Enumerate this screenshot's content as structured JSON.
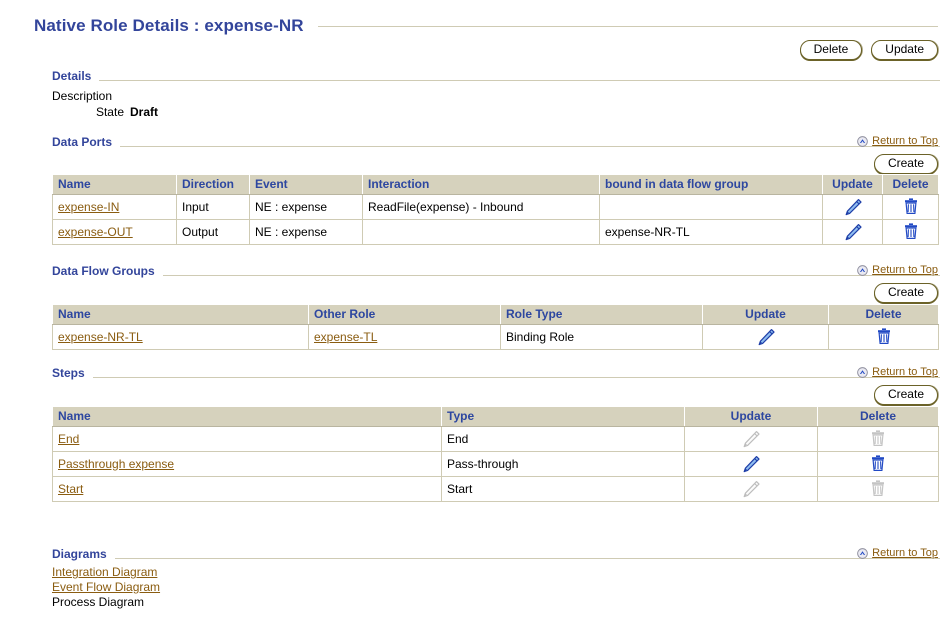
{
  "page": {
    "title": "Native Role Details : expense-NR",
    "top_buttons": [
      {
        "label": "Delete",
        "name": "delete-button"
      },
      {
        "label": "Update",
        "name": "update-button"
      }
    ]
  },
  "details": {
    "heading": "Details",
    "rows": [
      {
        "label": "Description",
        "value": ""
      },
      {
        "label": "State",
        "value": "Draft"
      }
    ]
  },
  "data_ports": {
    "heading": "Data Ports",
    "return_to_top": "Return to Top",
    "create_label": "Create",
    "columns": [
      "Name",
      "Direction",
      "Event",
      "Interaction",
      "bound in data flow group",
      "Update",
      "Delete"
    ],
    "rows": [
      {
        "name": "expense-IN",
        "direction": "Input",
        "event": "NE : expense",
        "interaction": "ReadFile(expense) - Inbound",
        "bound_in_data_flow_group": "",
        "update_enabled": true,
        "delete_enabled": true
      },
      {
        "name": "expense-OUT",
        "direction": "Output",
        "event": "NE : expense",
        "interaction": "",
        "bound_in_data_flow_group": "expense-NR-TL",
        "update_enabled": true,
        "delete_enabled": true
      }
    ]
  },
  "data_flow_groups": {
    "heading": "Data Flow Groups",
    "return_to_top": "Return to Top",
    "create_label": "Create",
    "columns": [
      "Name",
      "Other Role",
      "Role Type",
      "Update",
      "Delete"
    ],
    "rows": [
      {
        "name": "expense-NR-TL",
        "other_role": "expense-TL",
        "role_type": "Binding Role",
        "update_enabled": true,
        "delete_enabled": true
      }
    ]
  },
  "steps": {
    "heading": "Steps",
    "return_to_top": "Return to Top",
    "create_label": "Create",
    "columns": [
      "Name",
      "Type",
      "Update",
      "Delete"
    ],
    "rows": [
      {
        "name": "End",
        "type": "End",
        "update_enabled": false,
        "delete_enabled": false
      },
      {
        "name": "Passthrough expense",
        "type": "Pass-through",
        "update_enabled": true,
        "delete_enabled": true
      },
      {
        "name": "Start",
        "type": "Start",
        "update_enabled": false,
        "delete_enabled": false
      }
    ]
  },
  "diagrams": {
    "heading": "Diagrams",
    "return_to_top": "Return to Top",
    "items": [
      {
        "label": "Integration Diagram",
        "is_link": true
      },
      {
        "label": "Event Flow Diagram",
        "is_link": true
      },
      {
        "label": "Process Diagram",
        "is_link": false
      }
    ]
  },
  "icons": {
    "update": "pencil-icon",
    "delete": "trash-icon",
    "return_to_top": "circled-up-caret-icon"
  },
  "colors": {
    "heading_blue": "#33459b",
    "link_brown": "#8a5c10",
    "table_header_bg": "#d6d2bd",
    "rule": "#cfcbb4",
    "icon_blue": "#2149c4",
    "icon_disabled": "#c0c0c0"
  }
}
